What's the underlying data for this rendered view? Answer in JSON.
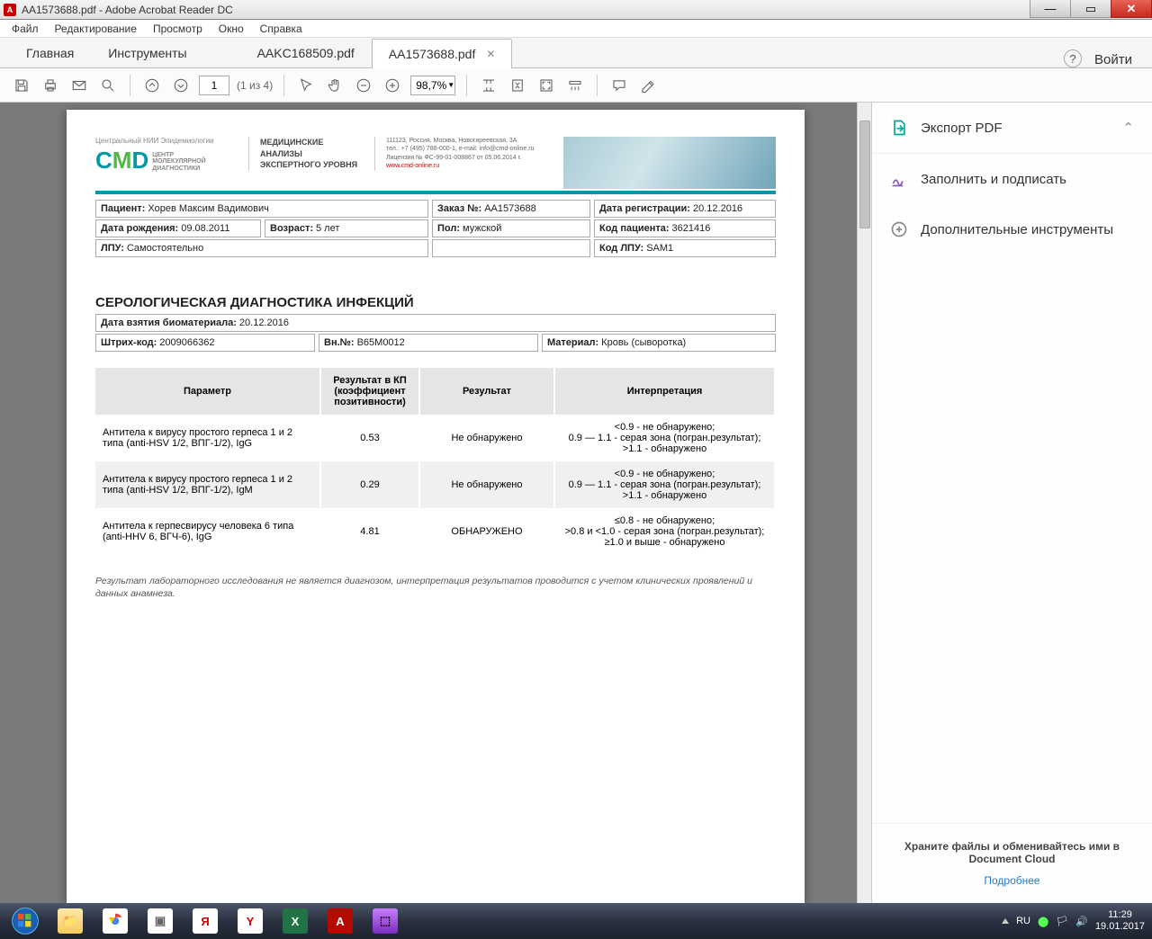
{
  "window": {
    "title": "AA1573688.pdf - Adobe Acrobat Reader DC"
  },
  "menu": {
    "file": "Файл",
    "edit": "Редактирование",
    "view": "Просмотр",
    "window": "Окно",
    "help": "Справка"
  },
  "apptabs": {
    "home": "Главная",
    "tools": "Инструменты",
    "doc1": "AAKC168509.pdf",
    "doc2": "AA1573688.pdf",
    "login": "Войти"
  },
  "toolbar": {
    "page": "1",
    "pageof": "(1 из 4)",
    "zoom": "98,7%"
  },
  "doc": {
    "lh": {
      "top": "Центральный НИИ Эпидемиологии",
      "sub": "ЦЕНТР\nМОЛЕКУЛЯРНОЙ\nДИАГНОСТИКИ",
      "mid": "МЕДИЦИНСКИЕ\nАНАЛИЗЫ\nЭКСПЕРТНОГО УРОВНЯ",
      "addr": "111123, Россия, Москва, Новогиреевская, 3А",
      "tel": "тел.: +7 (495) 788-000-1, e-mail: info@cmd-online.ru",
      "lic": "Лицензия № ФС-99-01-008867 от 05.06.2014 г.",
      "url": "www.cmd-online.ru"
    },
    "patient": {
      "name_l": "Пациент:",
      "name": "Хорев Максим Вадимович",
      "order_l": "Заказ №:",
      "order": "AA1573688",
      "reg_l": "Дата регистрации:",
      "reg": "20.12.2016",
      "dob_l": "Дата рождения:",
      "dob": "09.08.2011",
      "age_l": "Возраст:",
      "age": "5 лет",
      "sex_l": "Пол:",
      "sex": "мужской",
      "code_l": "Код пациента:",
      "code": "3621416",
      "lpu_l": "ЛПУ:",
      "lpu": "Самостоятельно",
      "lpucode_l": "Код ЛПУ:",
      "lpucode": "SAM1"
    },
    "section": "СЕРОЛОГИЧЕСКАЯ ДИАГНОСТИКА ИНФЕКЦИЙ",
    "sample": {
      "date_l": "Дата взятия биоматериала:",
      "date": "20.12.2016",
      "bar_l": "Штрих-код:",
      "bar": "2009066362",
      "vn_l": "Вн.№:",
      "vn": "B65M0012",
      "mat_l": "Материал:",
      "mat": "Кровь (сыворотка)"
    },
    "headers": {
      "p": "Параметр",
      "kp": "Результат в КП (коэффициент позитивности)",
      "r": "Результат",
      "i": "Интерпретация"
    },
    "rows": {
      "r1": {
        "p": "Антитела к вирусу простого герпеса 1 и 2 типа (anti-HSV 1/2, ВПГ-1/2), IgG",
        "kp": "0.53",
        "r": "Не обнаружено",
        "i": "<0.9 - не обнаружено;\n0.9 — 1.1 - серая зона (погран.результат);\n>1.1 - обнаружено"
      },
      "r2": {
        "p": "Антитела к вирусу простого герпеса 1 и 2 типа (anti-HSV 1/2, ВПГ-1/2), IgM",
        "kp": "0.29",
        "r": "Не обнаружено",
        "i": "<0.9 - не обнаружено;\n0.9 — 1.1 - серая зона (погран.результат);\n>1.1 - обнаружено"
      },
      "r3": {
        "p": "Антитела к герпесвирусу человека 6 типа (anti-HHV 6, ВГЧ-6), IgG",
        "kp": "4.81",
        "r": "ОБНАРУЖЕНО",
        "i": "≤0.8 - не обнаружено;\n>0.8 и <1.0 - серая зона (погран.результат);\n≥1.0 и выше - обнаружено"
      }
    },
    "disclaimer": "Результат лабораторного исследования не является диагнозом, интерпретация результатов проводится с учетом клинических проявлений и данных анамнеза."
  },
  "sidebar": {
    "export": "Экспорт PDF",
    "fill": "Заполнить и подписать",
    "more": "Дополнительные инструменты",
    "foot": "Храните файлы и обменивайтесь ими в Document Cloud",
    "link": "Подробнее"
  },
  "taskbar": {
    "lang": "RU",
    "time": "11:29",
    "date": "19.01.2017"
  }
}
